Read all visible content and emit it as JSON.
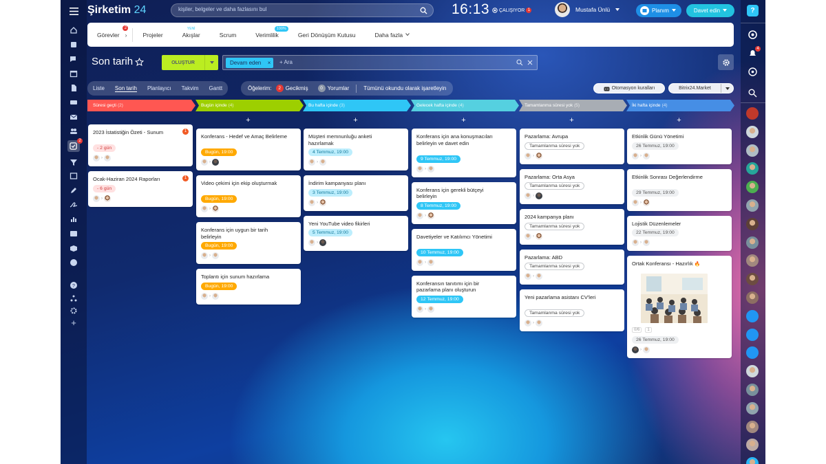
{
  "app": {
    "logo": "Şirketim",
    "logo_num": "24",
    "search_placeholder": "kişiler, belgeler ve daha fazlasını bul",
    "clock": "16:13",
    "working": "ÇALIŞIYOR",
    "working_badge": "1",
    "user_name": "Mustafa Ünlü",
    "plan_label": "Planım",
    "invite_label": "Davet edin"
  },
  "nav": {
    "items": [
      {
        "label": "Görevler",
        "badge": "2",
        "kind": "tasks"
      },
      {
        "label": "Projeler"
      },
      {
        "label": "Akışlar",
        "tiny": "YENİ"
      },
      {
        "label": "Scrum"
      },
      {
        "label": "Verimlilik",
        "pill": "100%"
      },
      {
        "label": "Geri Dönüşüm Kutusu"
      },
      {
        "label": "Daha fazla",
        "dropdown": true
      }
    ]
  },
  "page": {
    "title": "Son tarih",
    "create_label": "OLUŞTUR",
    "filter_tag": "Devam eden",
    "filter_placeholder": "+ Ara"
  },
  "views": {
    "items": [
      "Liste",
      "Son tarih",
      "Planlayıcı",
      "Takvim",
      "Gantt"
    ],
    "active": "Son tarih"
  },
  "counters": {
    "label": "Öğelerim:",
    "overdue_count": "2",
    "overdue_label": "Gecikmiş",
    "comments_count": "0",
    "comments_label": "Yorumlar",
    "mark_read": "Tümünü okundu olarak işaretleyin"
  },
  "automation_label": "Otomasyon kuralları",
  "market_label": "Bitrix24.Market",
  "columns": [
    {
      "title": "Süresi geçti",
      "count": "(2)",
      "color": "#ff5752",
      "cards": [
        {
          "title": "2023 İstatistiğin Özeti - Sunum",
          "deadline": "- 2 gün",
          "style": "red",
          "counter": "1",
          "h": 41,
          "people": [
            "m",
            "m"
          ]
        },
        {
          "title": "Ocak-Haziran 2024 Raporları",
          "deadline": "- 6 gün",
          "style": "red",
          "counter": "1",
          "h": 32,
          "people": [
            "m",
            "w"
          ]
        }
      ]
    },
    {
      "title": "Bugün içinde",
      "count": "(4)",
      "color": "#9dcf00",
      "cards": [
        {
          "title": "Konferans - Hedef ve Amaç Belirleme",
          "deadline": "Bugün, 19:00",
          "style": "orange",
          "h": 41,
          "people": [
            "m",
            "d"
          ]
        },
        {
          "title": "Video çekimi için ekip oluşturmak",
          "deadline": "Bugün, 19:00",
          "style": "orange",
          "h": 41,
          "people": [
            "m",
            "w"
          ]
        },
        {
          "title": "Konferans için uygun bir tarih belirleyin",
          "deadline": "Bugün, 19:00",
          "style": "orange",
          "h": 41,
          "people": [
            "m",
            "m"
          ]
        },
        {
          "title": "Toplantı için sunum hazırlama",
          "deadline": "Bugün, 19:00",
          "style": "orange",
          "h": 32,
          "people": [
            "m",
            "m"
          ]
        }
      ]
    },
    {
      "title": "Bu hafta içinde",
      "count": "(3)",
      "color": "#2fc6f6",
      "cards": [
        {
          "title": "Müşteri memnunluğu anketi hazırlamak",
          "deadline": "4 Temmuz, 19:00",
          "style": "blue",
          "h": 41,
          "people": [
            "m",
            "m"
          ]
        },
        {
          "title": "İndirim kampanyası planı",
          "deadline": "3 Temmuz, 19:00",
          "style": "blue",
          "h": 32,
          "people": [
            "m",
            "w"
          ]
        },
        {
          "title": "Yeni YouTube video fikirleri",
          "deadline": "5 Temmuz, 19:00",
          "style": "blue",
          "h": 32,
          "people": [
            "m",
            "d"
          ]
        }
      ]
    },
    {
      "title": "Gelecek hafta içinde",
      "count": "(4)",
      "color": "#55d0e0",
      "cards": [
        {
          "title": "Konferans için ana konuşmacıları belirleyin ve davet edin",
          "deadline": "9 Temmuz, 19:00",
          "style": "teal",
          "h": 51,
          "people": [
            "m",
            "m"
          ]
        },
        {
          "title": "Konferans için gerekli bütçeyi belirleyin",
          "deadline": "8 Temmuz, 19:00",
          "style": "teal",
          "h": 41,
          "people": [
            "m",
            "w"
          ]
        },
        {
          "title": "Davetiyeler ve Katılımcı Yönetimi",
          "deadline": "10 Temmuz, 19:00",
          "style": "teal",
          "h": 41,
          "people": [
            "m",
            "m"
          ]
        },
        {
          "title": "Konferansın tanıtımı için bir pazarlama planı oluşturun",
          "deadline": "12 Temmuz, 19:00",
          "style": "teal",
          "h": 41,
          "people": [
            "m",
            "m"
          ]
        }
      ]
    },
    {
      "title": "Tamamlanma süresi yok",
      "count": "(5)",
      "color": "#a8adb4",
      "cards": [
        {
          "title": "Pazarlama: Avrupa",
          "deadline": "Tamamlanma süresi yok",
          "style": "outline",
          "h": 32,
          "people": [
            "m",
            "w"
          ]
        },
        {
          "title": "Pazarlama: Orta Asya",
          "deadline": "Tamamlanma süresi yok",
          "style": "outline",
          "h": 32,
          "people": [
            "m",
            "d"
          ]
        },
        {
          "title": "2024 kampanya planı",
          "deadline": "Tamamlanma süresi yok",
          "style": "outline",
          "h": 32,
          "people": [
            "m",
            "w"
          ]
        },
        {
          "title": "Pazarlama: ABD",
          "deadline": "Tamamlanma süresi yok",
          "style": "outline",
          "h": 32,
          "people": [
            "m",
            "m"
          ]
        },
        {
          "title": "Yeni pazarlama asistanı CV'leri",
          "deadline": "Tamamlanma süresi yok",
          "style": "outline",
          "h": 41,
          "people": [
            "m",
            "m"
          ]
        }
      ]
    },
    {
      "title": "İki hafta içinde",
      "count": "(4)",
      "color": "#468ee5",
      "cards": [
        {
          "title": "Etkinlik Günü Yönetimi",
          "deadline": "26 Temmuz, 19:00",
          "style": "gray",
          "h": 32,
          "people": [
            "m",
            "m"
          ]
        },
        {
          "title": "Etkinlik Sonrası Değerlendirme",
          "deadline": "29 Temmuz, 19:00",
          "style": "gray",
          "h": 41,
          "people": [
            "m",
            "w"
          ]
        },
        {
          "title": "Lojistik Düzenlemeler",
          "deadline": "22 Temmuz, 19:00",
          "style": "gray",
          "h": 32,
          "people": [
            "m",
            "m"
          ]
        },
        {
          "title": "Ortak Konferansı - Hazırlık",
          "deadline": "26 Temmuz, 19:00",
          "style": "gray",
          "h": 125,
          "fire": true,
          "photo": true,
          "meta": [
            "0/6",
            "1"
          ],
          "people": [
            "d",
            "m"
          ]
        }
      ]
    }
  ]
}
